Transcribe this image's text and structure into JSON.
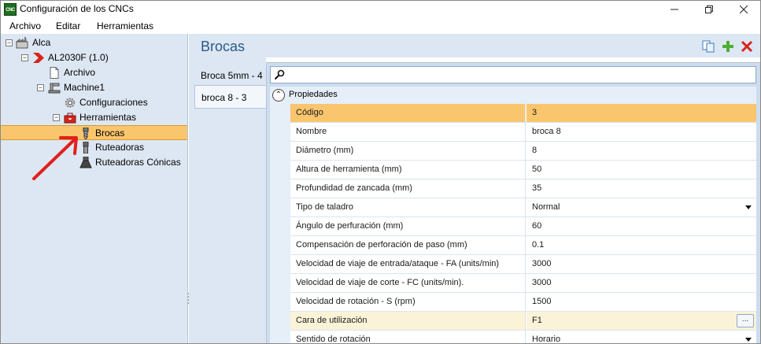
{
  "window": {
    "title": "Configuración de los CNCs",
    "app_icon_text": "CNC",
    "minimize_icon": "minimize-icon",
    "maximize_icon": "restore-icon",
    "close_icon": "close-icon"
  },
  "menu": {
    "archivo": "Archivo",
    "editar": "Editar",
    "herramientas": "Herramientas"
  },
  "tree": {
    "root": "Alca",
    "machine_model": "AL2030F (1.0)",
    "archivo": "Archivo",
    "machine": "Machine1",
    "configuraciones": "Configuraciones",
    "herramientas": "Herramientas",
    "brocas": "Brocas",
    "ruteadoras": "Ruteadoras",
    "ruteadoras_conicas": "Ruteadoras Cónicas"
  },
  "content": {
    "title": "Brocas",
    "tabs": [
      "Broca 5mm - 4",
      "broca 8 - 3"
    ],
    "category": "Propiedades",
    "properties": [
      {
        "name": "Código",
        "value": "3"
      },
      {
        "name": "Nombre",
        "value": "broca 8"
      },
      {
        "name": "Diámetro (mm)",
        "value": "8"
      },
      {
        "name": "Altura de herramienta (mm)",
        "value": "50"
      },
      {
        "name": "Profundidad de zancada (mm)",
        "value": "35"
      },
      {
        "name": "Tipo de taladro",
        "value": "Normal"
      },
      {
        "name": "Ángulo de perfuración (mm)",
        "value": "60"
      },
      {
        "name": "Compensación de perforación de paso (mm)",
        "value": "0.1"
      },
      {
        "name": "Velocidad de viaje de entrada/ataque - FA (units/min)",
        "value": "3000"
      },
      {
        "name": "Velocidad de viaje de corte - FC (units/min).",
        "value": "3000"
      },
      {
        "name": "Velocidad de rotación - S (rpm)",
        "value": "1500"
      },
      {
        "name": "Cara de utilización",
        "value": "F1"
      },
      {
        "name": "Sentido de rotación",
        "value": "Horario"
      }
    ],
    "ellipsis_label": "..."
  },
  "colors": {
    "selection": "#f9c66e",
    "panel": "#dde7f3",
    "title": "#2a5a8a",
    "annotation_arrow": "#e0201b"
  }
}
